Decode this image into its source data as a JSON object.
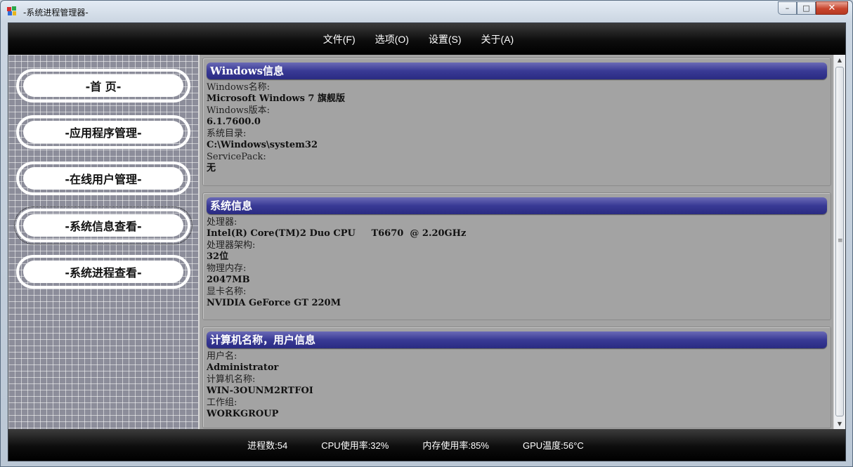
{
  "window": {
    "title": "-系统进程管理器-",
    "controls": {
      "minimize": "–",
      "maximize": "□",
      "close": "✕"
    }
  },
  "menu": [
    {
      "label": "文件(F)"
    },
    {
      "label": "选项(O)"
    },
    {
      "label": "设置(S)"
    },
    {
      "label": "关于(A)"
    }
  ],
  "sidebar": {
    "items": [
      {
        "label": "-首 页-"
      },
      {
        "label": "-应用程序管理-"
      },
      {
        "label": "-在线用户管理-"
      },
      {
        "label": "-系统信息查看-"
      },
      {
        "label": "-系统进程查看-"
      }
    ],
    "focused_index": 3
  },
  "sections": [
    {
      "title": "Windows信息",
      "fields": [
        {
          "label": "Windows名称:",
          "value": "Microsoft Windows 7 旗舰版"
        },
        {
          "label": "Windows版本:",
          "value": "6.1.7600.0"
        },
        {
          "label": "系统目录:",
          "value": "C:\\Windows\\system32"
        },
        {
          "label": "ServicePack:",
          "value": "无"
        }
      ]
    },
    {
      "title": "系统信息",
      "fields": [
        {
          "label": "处理器:",
          "value": "Intel(R) Core(TM)2 Duo CPU     T6670  @ 2.20GHz"
        },
        {
          "label": "处理器架构:",
          "value": "32位"
        },
        {
          "label": "物理内存:",
          "value": "2047MB"
        },
        {
          "label": "显卡名称:",
          "value": "NVIDIA GeForce GT 220M"
        }
      ]
    },
    {
      "title": "计算机名称，用户信息",
      "fields": [
        {
          "label": "用户名:",
          "value": "Administrator"
        },
        {
          "label": "计算机名称:",
          "value": "WIN-3OUNM2RTFOI"
        },
        {
          "label": "工作组:",
          "value": "WORKGROUP"
        }
      ]
    }
  ],
  "status": {
    "processes": "进程数:54",
    "cpu": "CPU使用率:32%",
    "memory": "内存使用率:85%",
    "gpu": "GPU温度:56°C"
  },
  "colors": {
    "section_header": "#393a95",
    "bar_background": "#000000",
    "content_background": "#a3a3a3"
  }
}
